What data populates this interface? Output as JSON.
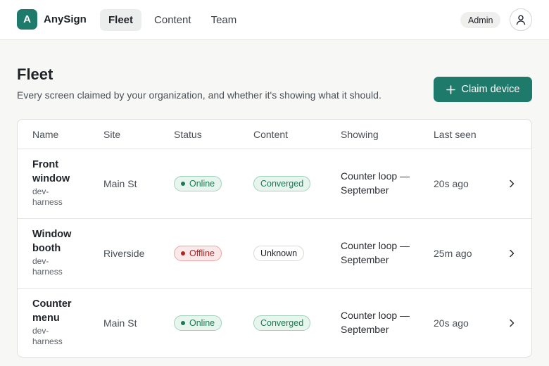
{
  "app": {
    "logo_letter": "A",
    "brand": "AnySign",
    "nav": [
      "Fleet",
      "Content",
      "Team"
    ],
    "role": "Admin"
  },
  "page": {
    "title": "Fleet",
    "subtitle": "Every screen claimed by your organization, and whether it's showing what it should.",
    "claim_button": "Claim device"
  },
  "table": {
    "columns": [
      "Name",
      "Site",
      "Status",
      "Content",
      "Showing",
      "Last seen"
    ],
    "rows": [
      {
        "name": "Front window",
        "source": "dev-harness",
        "site": "Main St",
        "status": "Online",
        "content": "Converged",
        "showing": "Counter loop — September",
        "last_seen": "20s ago"
      },
      {
        "name": "Window booth",
        "source": "dev-harness",
        "site": "Riverside",
        "status": "Offline",
        "content": "Unknown",
        "showing": "Counter loop — September",
        "last_seen": "25m ago"
      },
      {
        "name": "Counter menu",
        "source": "dev-harness",
        "site": "Main St",
        "status": "Online",
        "content": "Converged",
        "showing": "Counter loop — September",
        "last_seen": "20s ago"
      }
    ]
  },
  "colors": {
    "brand": "#1e7a6a",
    "online": "#1d7a52",
    "offline": "#b42323"
  },
  "icons": {
    "claim": "plus-icon",
    "avatar": "user-icon",
    "row_action": "chevron-right-icon"
  }
}
